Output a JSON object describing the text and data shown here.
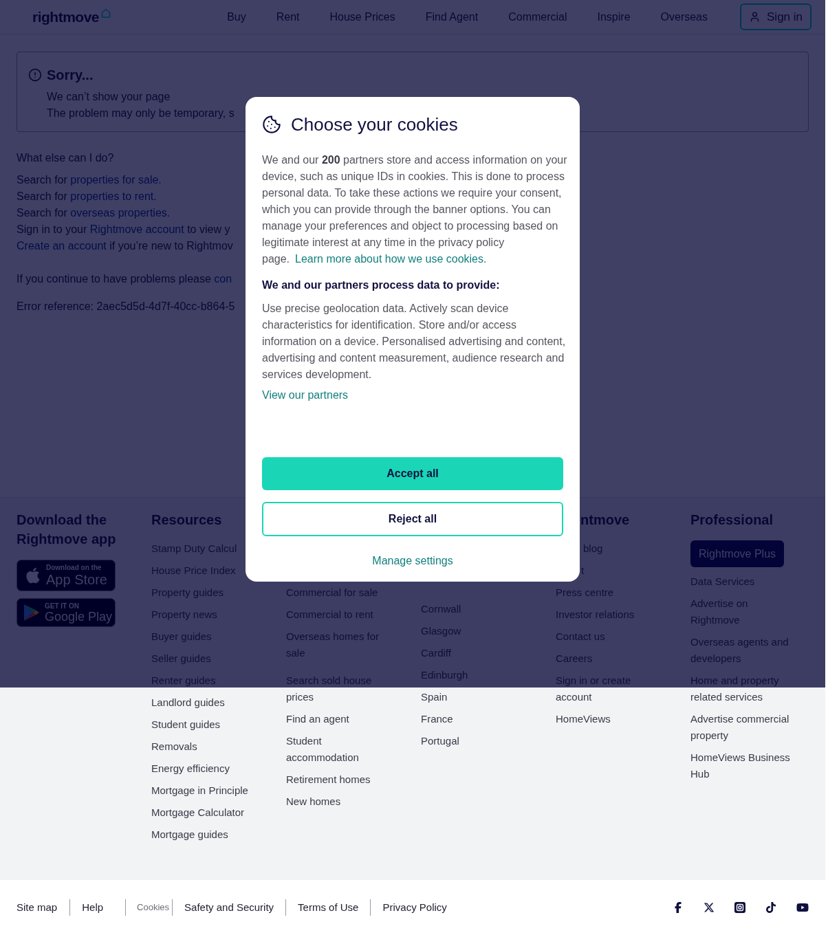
{
  "header": {
    "logo": "rightmove",
    "nav": [
      "Buy",
      "Rent",
      "House Prices",
      "Find Agent",
      "Commercial",
      "Inspire",
      "Overseas"
    ],
    "sign_in": "Sign in"
  },
  "error_notice": {
    "title": "Sorry...",
    "lines": [
      "We can’t show your page",
      "The problem may only be temporary, s"
    ]
  },
  "help": {
    "heading": "What else can I do?",
    "lines": [
      [
        {
          "kind": "text",
          "text": "Search for "
        },
        {
          "kind": "link",
          "text": "properties for sale."
        }
      ],
      [
        {
          "kind": "text",
          "text": "Search for "
        },
        {
          "kind": "link",
          "text": "properties to rent."
        }
      ],
      [
        {
          "kind": "text",
          "text": "Search for "
        },
        {
          "kind": "link",
          "text": "overseas properties."
        }
      ],
      [
        {
          "kind": "text",
          "text": "Sign in to your "
        },
        {
          "kind": "link",
          "text": "Rightmove account"
        },
        {
          "kind": "text",
          "text": " to view y"
        }
      ],
      [
        {
          "kind": "link",
          "text": "Create an account"
        },
        {
          "kind": "text",
          "text": " if you’re new to Rightmov"
        }
      ]
    ],
    "contact": [
      {
        "kind": "text",
        "text": "If you continue to have problems please "
      },
      {
        "kind": "link",
        "text": "con"
      }
    ],
    "error_reference": "Error reference: 2aec5d5d-4d7f-40cc-b864-5"
  },
  "cookie_dialog": {
    "title": "Choose your cookies",
    "intro": "We and our **200** partners store and access information on your device, such as unique IDs in cookies. This is done to process personal data. To take these actions we require your consent, which you can provide through the banner options. You can manage your preferences and object to processing based on legitimate interest at any time in the privacy policy page.",
    "intro_link": "Learn more about how we use cookies.",
    "purposes_heading": "We and our partners process data to provide:",
    "purposes": "Use precise geolocation data. Actively scan device characteristics for identification. Store and/or access information on a device. Personalised advertising and content, advertising and content measurement, audience research and services development.",
    "partners_link": "View our partners",
    "buttons": [
      {
        "kind": "primary",
        "label": "Accept all"
      },
      {
        "kind": "secondary",
        "label": "Reject all"
      },
      {
        "kind": "link",
        "label": "Manage settings"
      }
    ]
  },
  "footer": {
    "columns": [
      {
        "heading": "Download the Rightmove app",
        "badges": [
          {
            "kind": "apple",
            "small": "Download on the",
            "large": "App Store"
          },
          {
            "kind": "google",
            "small": "GET IT ON",
            "large": "Google Play"
          }
        ]
      },
      {
        "heading": "Resources",
        "links": [
          "Stamp Duty Calcul",
          "House Price Index",
          "Property guides",
          "Property news",
          "Buyer guides",
          "Seller guides",
          "Renter guides",
          "Landlord guides",
          "Student guides",
          "Removals",
          "Energy efficiency",
          "Mortgage in Principle",
          "Mortgage Calculator",
          "Mortgage guides"
        ]
      },
      {
        "links": [
          "Commercial for sale",
          "Commercial to rent",
          "Overseas homes for sale",
          "Search sold house prices",
          "Find an agent",
          "Student accommodation",
          "Retirement homes",
          "New homes"
        ]
      },
      {
        "links": [
          "Cornwall",
          "Glasgow",
          "Cardiff",
          "Edinburgh",
          "Spain",
          "France",
          "Portugal"
        ]
      },
      {
        "heading": "ntmove",
        "links": [
          "blog",
          "t",
          "Press centre",
          "Investor relations",
          "Contact us",
          "Careers",
          "Sign in or create account",
          "HomeViews"
        ]
      },
      {
        "heading": "Professional",
        "button": "Rightmove Plus",
        "links": [
          "Data Services",
          "Advertise on Rightmove",
          "Overseas agents and developers",
          "Home and property related services",
          "Advertise commercial property",
          "HomeViews Business Hub"
        ]
      }
    ]
  },
  "bottom_bar": {
    "links": [
      {
        "kind": "link",
        "label": "Site map"
      },
      {
        "kind": "link",
        "label": "Help"
      },
      {
        "kind": "cookie_button",
        "label": "Cookies"
      },
      {
        "kind": "link",
        "label": "Safety and Security"
      },
      {
        "kind": "link",
        "label": "Terms of Use"
      },
      {
        "kind": "link",
        "label": "Privacy Policy"
      }
    ]
  }
}
